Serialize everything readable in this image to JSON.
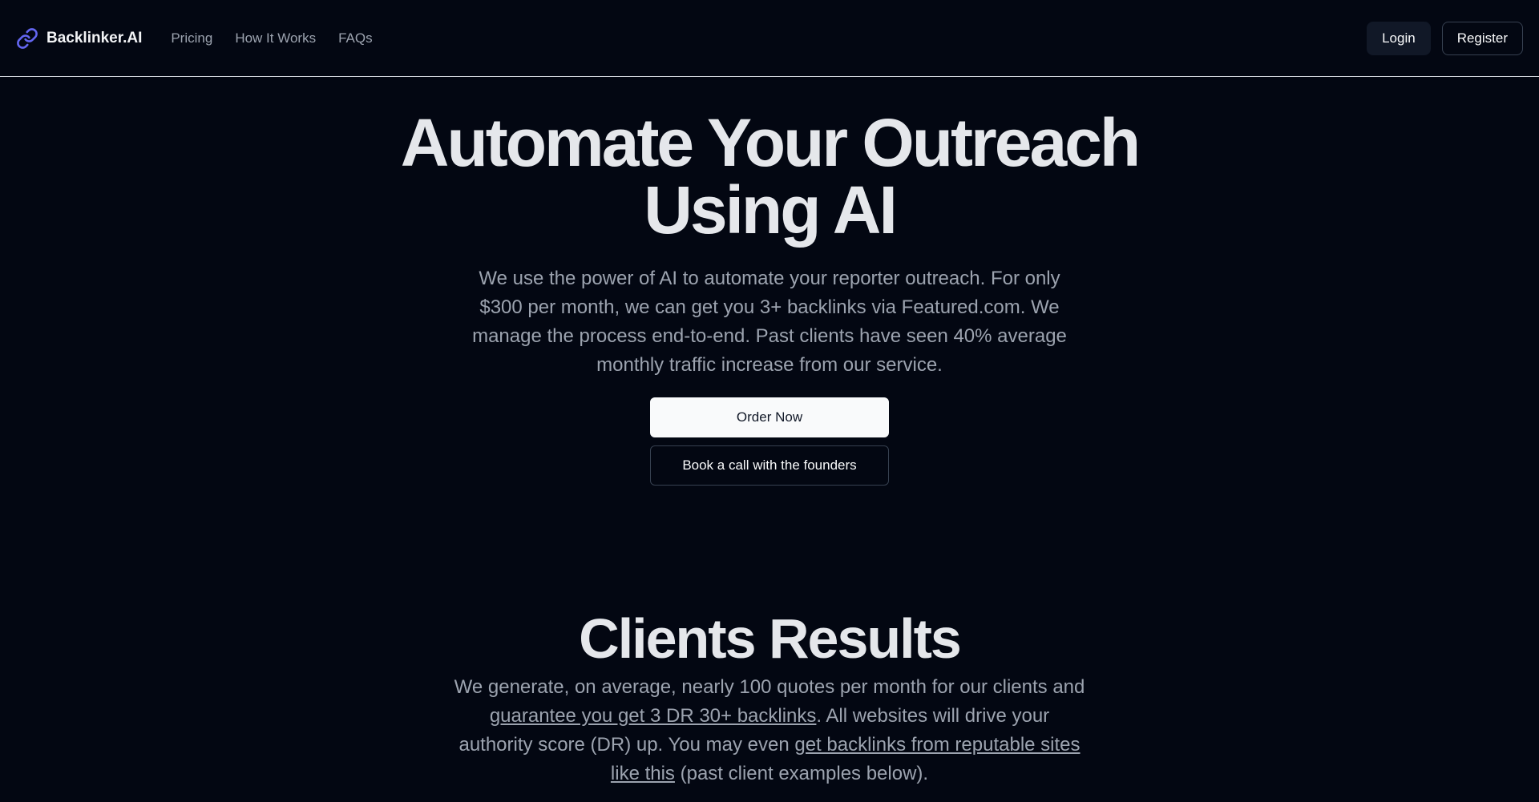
{
  "header": {
    "brand": "Backlinker.AI",
    "nav": [
      "Pricing",
      "How It Works",
      "FAQs"
    ],
    "login_label": "Login",
    "register_label": "Register"
  },
  "hero": {
    "title_line1": "Automate Your Outreach",
    "title_line2": "Using AI",
    "subtitle": "We use the power of AI to automate your reporter outreach. For only $300 per month, we can get you 3+ backlinks via Featured.com. We manage the process end-to-end. Past clients have seen 40% average monthly traffic increase from our service.",
    "order_label": "Order Now",
    "book_label": "Book a call with the founders"
  },
  "results": {
    "title": "Clients Results",
    "text_part1": "We generate, on average, nearly 100 quotes per month for our clients and ",
    "link1": "guarantee you get 3 DR 30+ backlinks",
    "text_part2": ". All websites will drive your authority score (DR) up. You may even ",
    "link2": "get backlinks from reputable sites like this",
    "text_part3": " (past client examples below)."
  },
  "colors": {
    "background": "#030712",
    "primary_button": "#f9fafb",
    "link_icon": "#6366f1"
  }
}
